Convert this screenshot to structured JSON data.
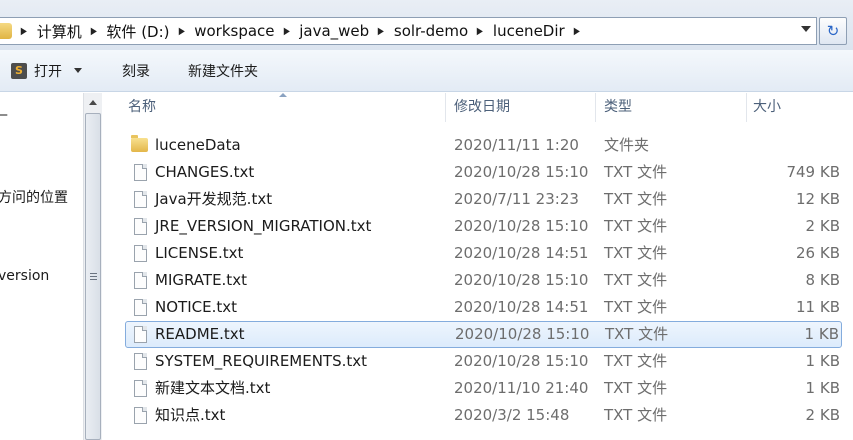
{
  "address": {
    "crumbs": [
      "计算机",
      "软件 (D:)",
      "workspace",
      "java_web",
      "solr-demo",
      "luceneDir"
    ]
  },
  "toolbar": {
    "open_label": "打开",
    "burn_label": "刻录",
    "new_folder_label": "新建文件夹"
  },
  "nav": {
    "partial_item_1": "方问的位置",
    "partial_item_2": "version"
  },
  "columns": {
    "name": "名称",
    "date": "修改日期",
    "type": "类型",
    "size": "大小"
  },
  "files": [
    {
      "name": "luceneData",
      "date": "2020/11/11 1:20",
      "type": "文件夹",
      "size": "",
      "kind": "folder-icon",
      "selected": false
    },
    {
      "name": "CHANGES.txt",
      "date": "2020/10/28 15:10",
      "type": "TXT 文件",
      "size": "749 KB",
      "kind": "txt-file-icon",
      "selected": false
    },
    {
      "name": "Java开发规范.txt",
      "date": "2020/7/11 23:23",
      "type": "TXT 文件",
      "size": "12 KB",
      "kind": "txt-file-icon",
      "selected": false
    },
    {
      "name": "JRE_VERSION_MIGRATION.txt",
      "date": "2020/10/28 15:10",
      "type": "TXT 文件",
      "size": "2 KB",
      "kind": "txt-file-icon",
      "selected": false
    },
    {
      "name": "LICENSE.txt",
      "date": "2020/10/28 14:51",
      "type": "TXT 文件",
      "size": "26 KB",
      "kind": "txt-file-icon",
      "selected": false
    },
    {
      "name": "MIGRATE.txt",
      "date": "2020/10/28 15:10",
      "type": "TXT 文件",
      "size": "8 KB",
      "kind": "txt-file-icon",
      "selected": false
    },
    {
      "name": "NOTICE.txt",
      "date": "2020/10/28 14:51",
      "type": "TXT 文件",
      "size": "11 KB",
      "kind": "txt-file-icon",
      "selected": false
    },
    {
      "name": "README.txt",
      "date": "2020/10/28 15:10",
      "type": "TXT 文件",
      "size": "1 KB",
      "kind": "txt-file-icon",
      "selected": true
    },
    {
      "name": "SYSTEM_REQUIREMENTS.txt",
      "date": "2020/10/28 15:10",
      "type": "TXT 文件",
      "size": "1 KB",
      "kind": "txt-file-icon",
      "selected": false
    },
    {
      "name": "新建文本文档.txt",
      "date": "2020/11/10 21:40",
      "type": "TXT 文件",
      "size": "1 KB",
      "kind": "txt-file-icon",
      "selected": false
    },
    {
      "name": "知识点.txt",
      "date": "2020/3/2 15:48",
      "type": "TXT 文件",
      "size": "2 KB",
      "kind": "txt-file-icon",
      "selected": false
    }
  ],
  "colors": {
    "selection_border": "#84acdd",
    "header_text": "#4c607a",
    "detail_text": "#6d6d6d"
  }
}
